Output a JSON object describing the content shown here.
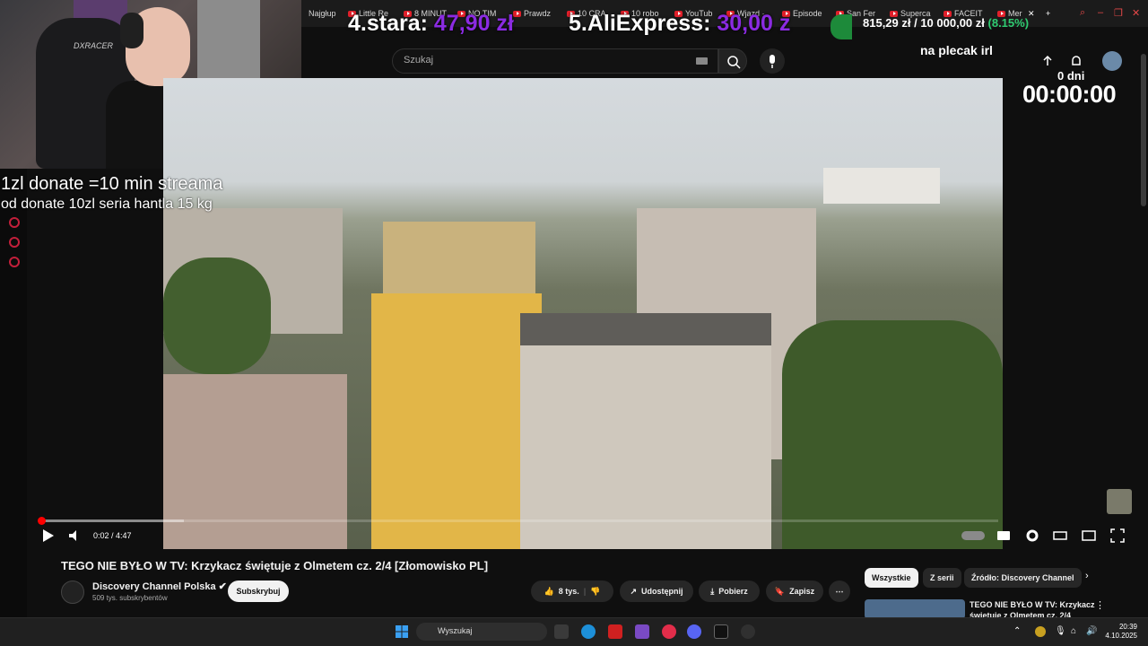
{
  "browser": {
    "tabs": [
      "Najgłup",
      "Little Re",
      "8 MINUT",
      "NO TIM",
      "Prawdz",
      "10 CRA",
      "10 robo",
      "YouTub",
      "Wjazd ·",
      "Episode",
      "San Fer",
      "Superca",
      "FACEIT",
      "Mer"
    ],
    "new_tab_icon": "plus-icon"
  },
  "overlay": {
    "item4_label": "4.stara:",
    "item4_price": "47,90 zł",
    "item5_label": "5.AliExpress:",
    "item5_price": "30,00 z",
    "goal_amount": "815,29 zł / 10 000,00 zł",
    "goal_pct": "(8.15%)",
    "goal_label": "na plecak irl",
    "days": "0 dni",
    "timer": "00:00:00",
    "donate_line1": "1zl donate =10 min streama",
    "donate_line2": "od donate 10zl seria hantla 15 kg"
  },
  "youtube": {
    "search_placeholder": "Szukaj",
    "video_time": "0:02 / 4:47",
    "progress_fraction": 0.007,
    "title": "TEGO NIE BYŁO W TV: Krzykacz świętuje z Olmetem cz. 2/4 [Złomowisko PL]",
    "channel_name": "Discovery Channel Polska",
    "channel_subs": "509 tys. subskrybentów",
    "subscribe_label": "Subskrybuj",
    "likes": "8 tys.",
    "share_label": "Udostępnij",
    "download_label": "Pobierz",
    "save_label": "Zapisz",
    "chips": [
      "Wszystkie",
      "Z serii",
      "Źródło: Discovery Channel"
    ],
    "rec_title": "TEGO NIE BYŁO W TV: Krzykacz świętuje z Olmetem cz. 2/4"
  },
  "taskbar": {
    "search_placeholder": "Wyszukaj",
    "time": "20:39",
    "date": "4.10.2025"
  },
  "colors": {
    "accent_purple": "#8b2be2",
    "accent_red": "#ff0000",
    "goal_green": "#2ecc71"
  }
}
